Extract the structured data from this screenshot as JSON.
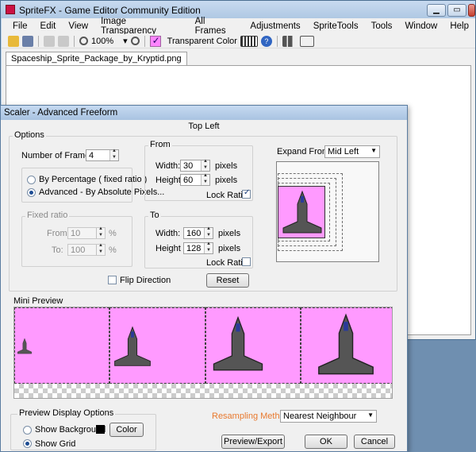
{
  "main_window": {
    "title": "SpriteFX - Game Editor Community Edition",
    "menu": [
      "File",
      "Edit",
      "View",
      "Image Transparency",
      "All Frames",
      "Adjustments",
      "SpriteTools",
      "Tools",
      "Window",
      "Help"
    ],
    "toolbar": {
      "zoom": "100%",
      "transparent_color_label": "Transparent Color"
    },
    "document_tab": "Spaceship_Sprite_Package_by_Kryptid.png"
  },
  "dialog": {
    "title": "Scaler - Advanced Freeform",
    "header": "Top Left",
    "options": {
      "label": "Options",
      "num_frames_label": "Number of Frames",
      "num_frames": "4",
      "by_percentage": "By Percentage ( fixed ratio )",
      "advanced": "Advanced - By Absolute Pixels..."
    },
    "from": {
      "label": "From",
      "width_label": "Width:",
      "width": "30",
      "height_label": "Height",
      "height": "60",
      "units": "pixels",
      "lock_ratio": "Lock Ratio"
    },
    "fixed_ratio": {
      "label": "Fixed ratio",
      "from_label": "From:",
      "from": "10",
      "to_label": "To:",
      "to": "100",
      "unit": "%"
    },
    "to": {
      "label": "To",
      "width_label": "Width:",
      "width": "160",
      "height_label": "Height",
      "height": "128",
      "units": "pixels",
      "lock_ratio": "Lock Ratio"
    },
    "flip_direction": "Flip Direction",
    "reset": "Reset",
    "expand_from_label": "Expand From:",
    "expand_from": "Mid Left",
    "mini_preview": "Mini Preview",
    "preview_display": {
      "label": "Preview Display Options",
      "show_background": "Show Background",
      "color_button": "Color",
      "show_grid": "Show Grid"
    },
    "resampling_label": "Resampling Method",
    "resampling": "Nearest Neighbour",
    "buttons": {
      "preview_export": "Preview/Export",
      "ok": "OK",
      "cancel": "Cancel"
    }
  },
  "colors": {
    "sprite_background": "#ff9aff",
    "resampling_label": "#e8792e"
  }
}
